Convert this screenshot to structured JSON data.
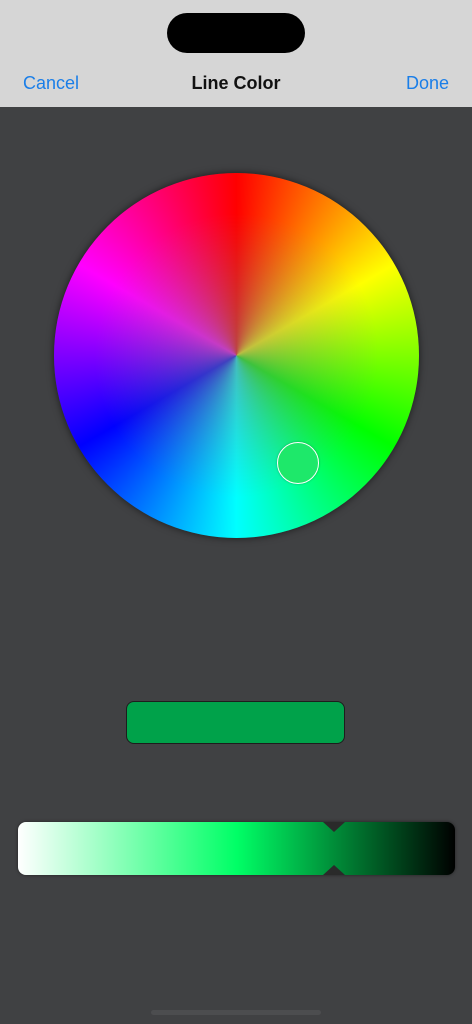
{
  "navbar": {
    "cancel_label": "Cancel",
    "title": "Line Color",
    "done_label": "Done"
  },
  "colors": {
    "accent": "#1a7ee8",
    "background": "#404143",
    "navbar_bg": "#d6d6d6",
    "selected_color": "#00a24a"
  }
}
